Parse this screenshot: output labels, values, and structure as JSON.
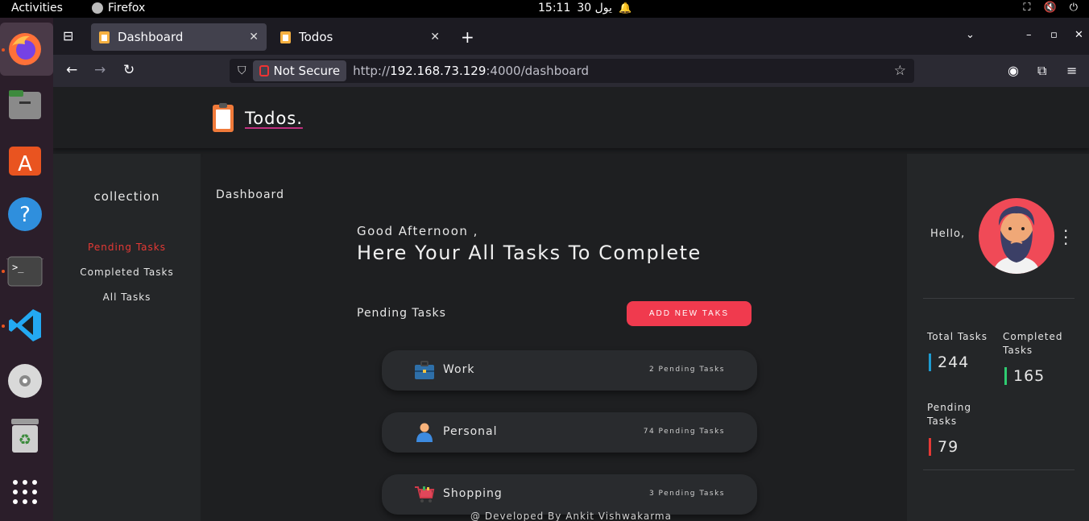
{
  "system": {
    "activities": "Activities",
    "app_name": "Firefox",
    "time": "15:11",
    "date": "يول 30"
  },
  "browser": {
    "tabs": [
      {
        "label": "Dashboard",
        "active": true
      },
      {
        "label": "Todos",
        "active": false
      }
    ],
    "not_secure": "Not Secure",
    "url_prefix": "http://",
    "url_host": "192.168.73.129",
    "url_rest": ":4000/dashboard"
  },
  "app": {
    "brand": "Todos."
  },
  "sidebar": {
    "title": "collection",
    "links": [
      {
        "label": "Pending Tasks",
        "active": true
      },
      {
        "label": "Completed Tasks",
        "active": false
      },
      {
        "label": "All Tasks",
        "active": false
      }
    ]
  },
  "main": {
    "breadcrumb": "Dashboard",
    "greeting": "Good Afternoon ,",
    "headline": "Here Your All Tasks To Complete",
    "pending_label": "Pending Tasks",
    "add_button": "ADD NEW TAKS",
    "tasks": [
      {
        "name": "Work",
        "count": "2 Pending Tasks",
        "icon": "briefcase-icon"
      },
      {
        "name": "Personal",
        "count": "74 Pending Tasks",
        "icon": "person-icon"
      },
      {
        "name": "Shopping",
        "count": "3 Pending Tasks",
        "icon": "cart-icon"
      }
    ]
  },
  "profile": {
    "hello": "Hello,",
    "stats": {
      "total_label": "Total Tasks",
      "total_value": "244",
      "completed_label": "Completed Tasks",
      "completed_value": "165",
      "pending_label": "Pending Tasks",
      "pending_value": "79"
    },
    "colors": {
      "total": "#1d9bd1",
      "completed": "#2ecc71",
      "pending": "#e53935"
    }
  },
  "footer": "@ Developed By Ankit Vishwakarma"
}
